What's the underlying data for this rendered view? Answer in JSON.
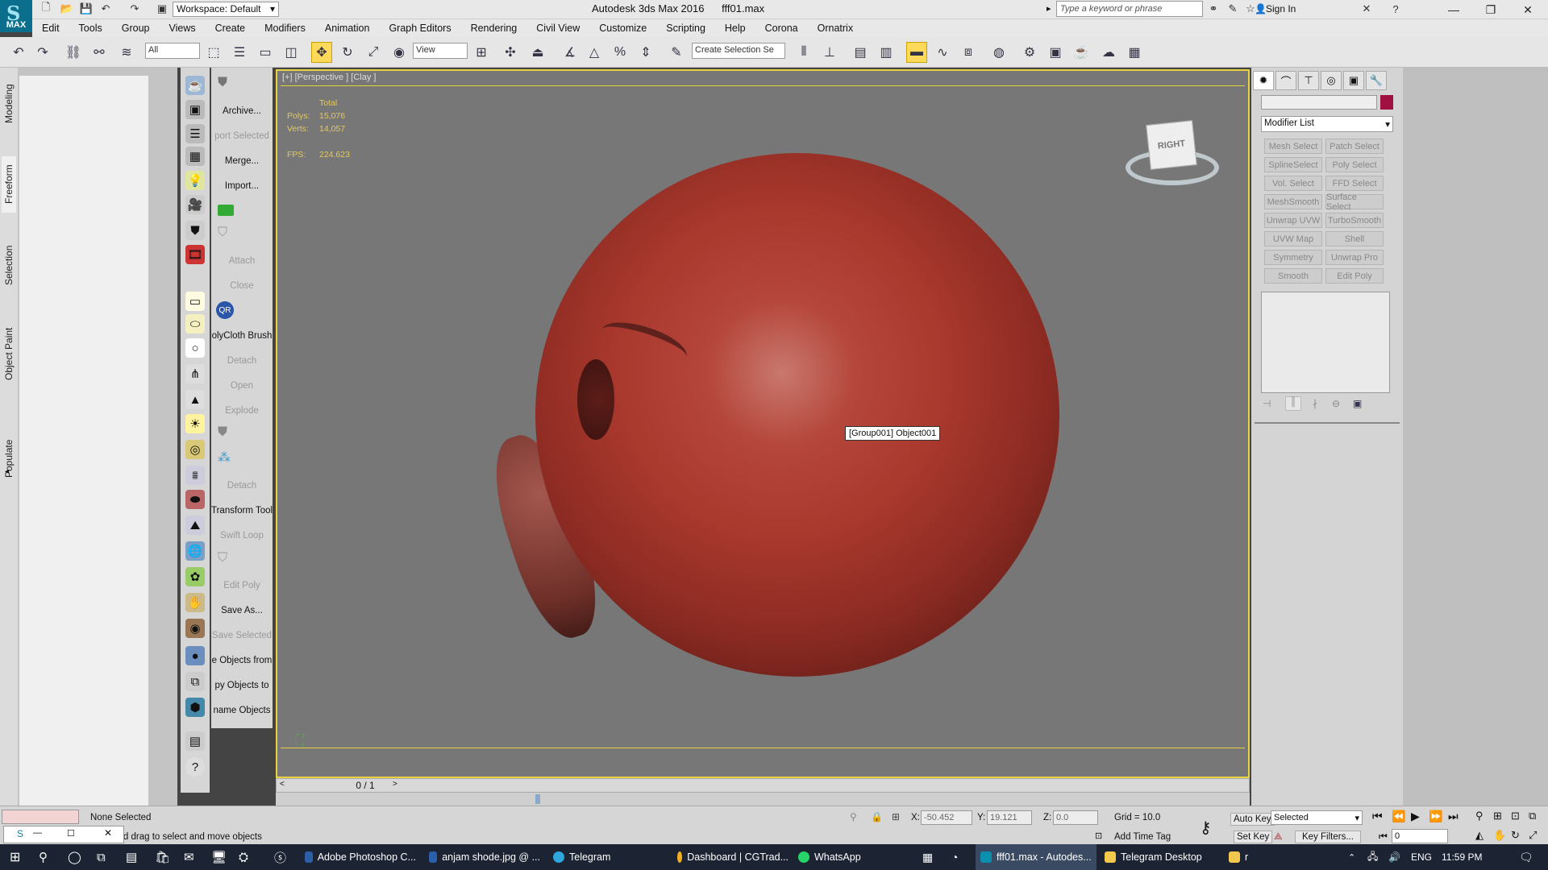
{
  "titlebar": {
    "logo": "MAX",
    "workspace": "Workspace: Default",
    "app_title": "Autodesk 3ds Max 2016      fff01.max",
    "search_placeholder": "Type a keyword or phrase",
    "sign_in": "Sign In"
  },
  "menu": [
    "Edit",
    "Tools",
    "Group",
    "Views",
    "Create",
    "Modifiers",
    "Animation",
    "Graph Editors",
    "Rendering",
    "Civil View",
    "Customize",
    "Scripting",
    "Help",
    "Corona",
    "Ornatrix"
  ],
  "toolbar": {
    "filter_value": "All",
    "refcoord_value": "View",
    "selection_set_placeholder": "Create Selection Se"
  },
  "left_tabs": [
    "Modeling",
    "Freeform",
    "Selection",
    "Object Paint",
    "Populate"
  ],
  "text_column": [
    {
      "label": "Archive...",
      "dim": false
    },
    {
      "label": "port Selected",
      "dim": true
    },
    {
      "label": "Merge...",
      "dim": false
    },
    {
      "label": "Import...",
      "dim": false
    },
    {
      "label": "",
      "dim": false
    },
    {
      "label": "",
      "dim": false
    },
    {
      "label": "Attach",
      "dim": true
    },
    {
      "label": "Close",
      "dim": true
    },
    {
      "label": "",
      "dim": false
    },
    {
      "label": "olyCloth Brush",
      "dim": false
    },
    {
      "label": "Detach",
      "dim": true
    },
    {
      "label": "Open",
      "dim": true
    },
    {
      "label": "Explode",
      "dim": true
    },
    {
      "label": "",
      "dim": false
    },
    {
      "label": "",
      "dim": false
    },
    {
      "label": "Detach",
      "dim": true
    },
    {
      "label": "Transform Tool",
      "dim": false
    },
    {
      "label": "Swift Loop",
      "dim": true
    },
    {
      "label": "",
      "dim": false
    },
    {
      "label": "Edit Poly",
      "dim": true
    },
    {
      "label": "Save As...",
      "dim": false
    },
    {
      "label": "Save Selected",
      "dim": true
    },
    {
      "label": "e Objects from",
      "dim": false
    },
    {
      "label": "py Objects to",
      "dim": false
    },
    {
      "label": "name Objects",
      "dim": false
    }
  ],
  "viewport": {
    "label": "[+] [Perspective ] [Clay ]",
    "stats": {
      "total_label": "Total",
      "polys_label": "Polys:",
      "polys_value": "15,076",
      "verts_label": "Verts:",
      "verts_value": "14,057",
      "fps_label": "FPS:",
      "fps_value": "224.623"
    },
    "tooltip": "[Group001] Object001",
    "viewcube_face": "RIGHT"
  },
  "timeslider": {
    "value": "0 / 1"
  },
  "command_panel": {
    "modifier_list": "Modifier List",
    "buttons": [
      "Mesh Select",
      "Patch Select",
      "SplineSelect",
      "Poly Select",
      "Vol. Select",
      "FFD Select",
      "MeshSmooth",
      "Surface Select",
      "Unwrap UVW",
      "TurboSmooth",
      "UVW Map",
      "Shell",
      "Symmetry",
      "Unwrap Pro",
      "Smooth",
      "Edit Poly"
    ],
    "swatch_color": "#a01040"
  },
  "status": {
    "selection": "None Selected",
    "prompt": "Click and drag to select and move objects",
    "x_label": "X:",
    "x_value": "-50.452",
    "y_label": "Y:",
    "y_value": "19.121",
    "z_label": "Z:",
    "z_value": "0.0",
    "grid": "Grid = 10.0",
    "add_time_tag": "Add Time Tag",
    "auto_key": "Auto Key",
    "set_key": "Set Key",
    "selected_dropdown": "Selected",
    "key_filters": "Key Filters...",
    "frame_value": "0"
  },
  "taskbar": {
    "items": [
      {
        "label": "Adobe Photoshop C...",
        "color": "#2b5fa8"
      },
      {
        "label": "anjam shode.jpg @ ...",
        "color": "#2b5fa8"
      },
      {
        "label": "Telegram",
        "color": "#2ea6de"
      },
      {
        "label": "Dashboard | CGTrad...",
        "color": "#f2b01e"
      },
      {
        "label": "WhatsApp",
        "color": "#25d366"
      },
      {
        "label": "fff01.max - Autodes...",
        "color": "#0a8fae"
      },
      {
        "label": "Telegram Desktop",
        "color": "#f2c94c"
      },
      {
        "label": "r",
        "color": "#f2c94c"
      }
    ],
    "lang": "ENG",
    "time": "11:59 PM"
  }
}
